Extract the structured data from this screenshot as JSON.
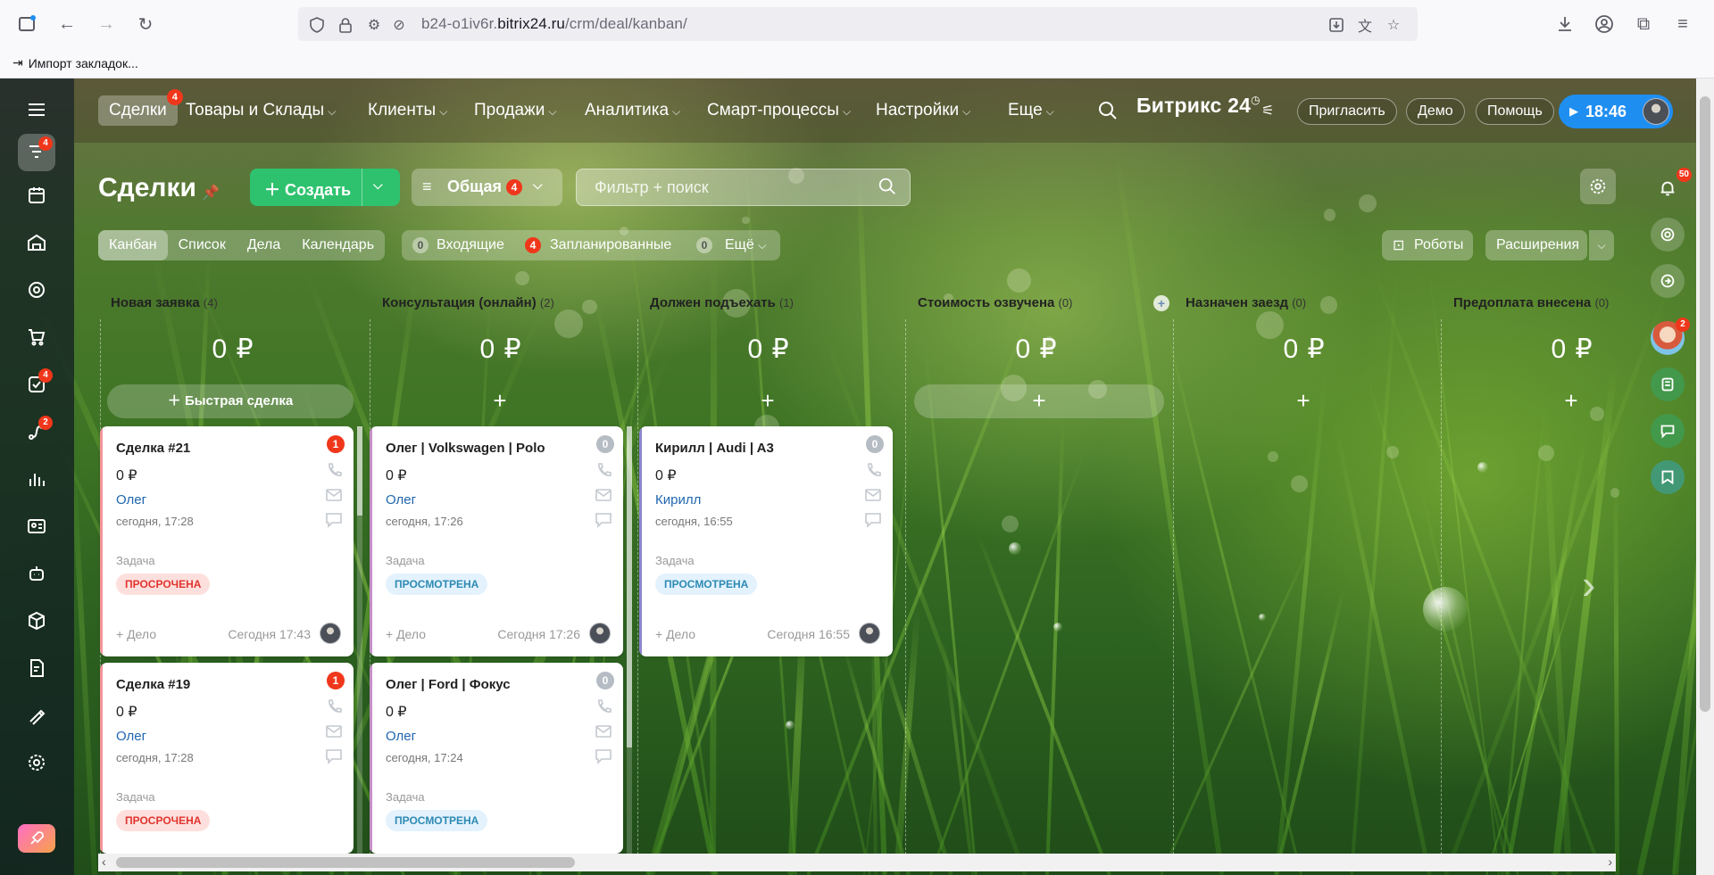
{
  "browser": {
    "url_host_prefix": "b24-o1iv6r.",
    "url_host_main": "bitrix24.ru",
    "url_path": "/crm/deal/kanban/",
    "bookmark": "Импорт закладок..."
  },
  "nav": {
    "items": [
      {
        "label": "Сделки",
        "badge": "4"
      },
      {
        "label": "Товары и Склады"
      },
      {
        "label": "Клиенты"
      },
      {
        "label": "Продажи"
      },
      {
        "label": "Аналитика"
      },
      {
        "label": "Смарт-процессы"
      },
      {
        "label": "Настройки"
      },
      {
        "label": "Еще"
      }
    ],
    "logo": "Битрикс 24",
    "invite": "Пригласить",
    "demo": "Демо",
    "help": "Помощь",
    "time": "18:46"
  },
  "sidebar": {
    "badges": {
      "crm": "4",
      "tasks": "4",
      "flows": "2"
    }
  },
  "right_rail": {
    "notifications": "50",
    "avatar_badge": "2"
  },
  "toolbar": {
    "title": "Сделки",
    "create": "Создать",
    "general": "Общая",
    "general_badge": "4",
    "filter_placeholder": "Фильтр + поиск",
    "robots": "Роботы",
    "extensions": "Расширения"
  },
  "view_tabs": [
    "Канбан",
    "Список",
    "Дела",
    "Календарь"
  ],
  "counters": {
    "incoming_count": "0",
    "incoming": "Входящие",
    "planned_count": "4",
    "planned": "Запланированные",
    "more_count": "0",
    "more": "Ещё"
  },
  "columns": [
    {
      "title": "Новая заявка",
      "count": "(4)",
      "sum": "0 ₽",
      "color": "#f39599",
      "add": "Быстрая сделка"
    },
    {
      "title": "Консультация (онлайн)",
      "count": "(2)",
      "sum": "0 ₽",
      "color": "#c58ec8"
    },
    {
      "title": "Должен подъехать",
      "count": "(1)",
      "sum": "0 ₽",
      "color": "#8b84d0"
    },
    {
      "title": "Стоимость озвучена",
      "count": "(0)",
      "sum": "0 ₽",
      "color": "#87aee0"
    },
    {
      "title": "Назначен заезд",
      "count": "(0)",
      "sum": "0 ₽",
      "color": "#6fcdd5"
    },
    {
      "title": "Предоплата внесена",
      "count": "(0)",
      "sum": "0 ₽",
      "color": "#a4db9e"
    }
  ],
  "cards": [
    {
      "title": "Сделка #21",
      "sum": "0 ₽",
      "contact": "Олег",
      "date": "сегодня, 17:28",
      "task": "Задача",
      "status": "ПРОСРОЧЕНА",
      "deal": "+ Дело",
      "time": "Сегодня 17:43",
      "badge": "1"
    },
    {
      "title": "Сделка #19",
      "sum": "0 ₽",
      "contact": "Олег",
      "date": "сегодня, 17:28",
      "task": "Задача",
      "status": "ПРОСРОЧЕНА",
      "badge": "1"
    },
    {
      "title": "Олег | Volkswagen | Polo",
      "sum": "0 ₽",
      "contact": "Олег",
      "date": "сегодня, 17:26",
      "task": "Задача",
      "status": "ПРОСМОТРЕНА",
      "deal": "+ Дело",
      "time": "Сегодня 17:26",
      "badge": "0"
    },
    {
      "title": "Олег | Ford | Фокус",
      "sum": "0 ₽",
      "contact": "Олег",
      "date": "сегодня, 17:24",
      "task": "Задача",
      "status": "ПРОСМОТРЕНА",
      "badge": "0"
    },
    {
      "title": "Кирилл | Audi | A3",
      "sum": "0 ₽",
      "contact": "Кирилл",
      "date": "сегодня, 16:55",
      "task": "Задача",
      "status": "ПРОСМОТРЕНА",
      "deal": "+ Дело",
      "time": "Сегодня 16:55",
      "badge": "0"
    }
  ]
}
